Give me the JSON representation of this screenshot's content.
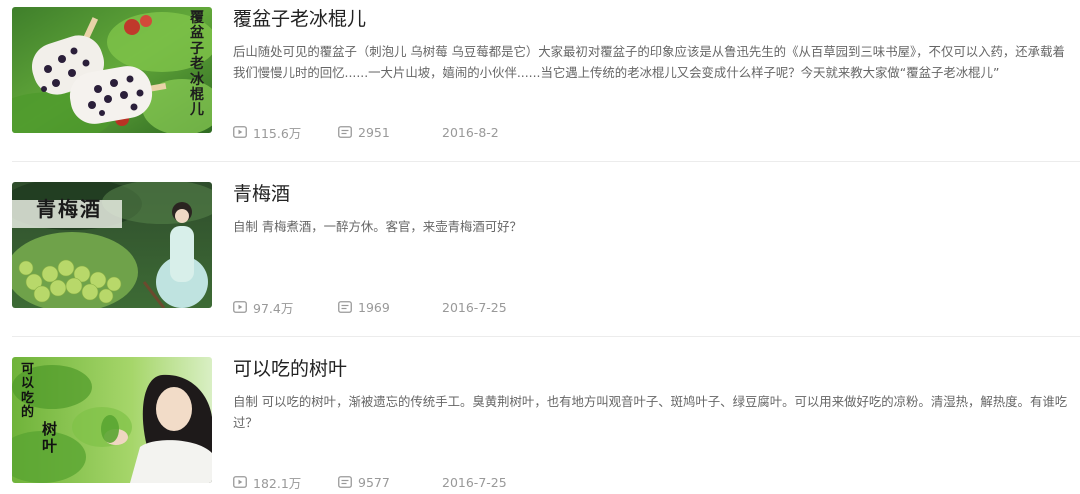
{
  "videos": [
    {
      "title": "覆盆子老冰棍儿",
      "description": "后山随处可见的覆盆子（刺泡儿 乌树莓 乌豆莓都是它）大家最初对覆盆子的印象应该是从鲁迅先生的《从百草园到三味书屋》，不仅可以入药，还承载着我们慢慢儿时的回忆......一大片山坡，嬉闹的小伙伴......当它遇上传统的老冰棍儿又会变成什么样子呢？今天就来教大家做“覆盆子老冰棍儿”",
      "views": "115.6万",
      "comments": "2951",
      "date": "2016-8-2",
      "thumb_caption": "覆盆子老冰棍儿"
    },
    {
      "title": "青梅酒",
      "description": "自制 青梅煮酒，一醉方休。客官，来壶青梅酒可好？",
      "views": "97.4万",
      "comments": "1969",
      "date": "2016-7-25",
      "thumb_caption": "青梅酒"
    },
    {
      "title": "可以吃的树叶",
      "description": "自制 可以吃的树叶，渐被遗忘的传统手工。臭黄荆树叶，也有地方叫观音叶子、斑鸠叶子、绿豆腐叶。可以用来做好吃的凉粉。清湿热，解热度。有谁吃过？",
      "views": "182.1万",
      "comments": "9577",
      "date": "2016-7-25",
      "thumb_caption_a": "可以吃的",
      "thumb_caption_b": "树叶"
    }
  ],
  "icons": {
    "views": "play-count-icon",
    "comments": "comment-count-icon"
  },
  "colors": {
    "title": "#222222",
    "description": "#666666",
    "meta": "#999999",
    "divider": "#ececec"
  }
}
